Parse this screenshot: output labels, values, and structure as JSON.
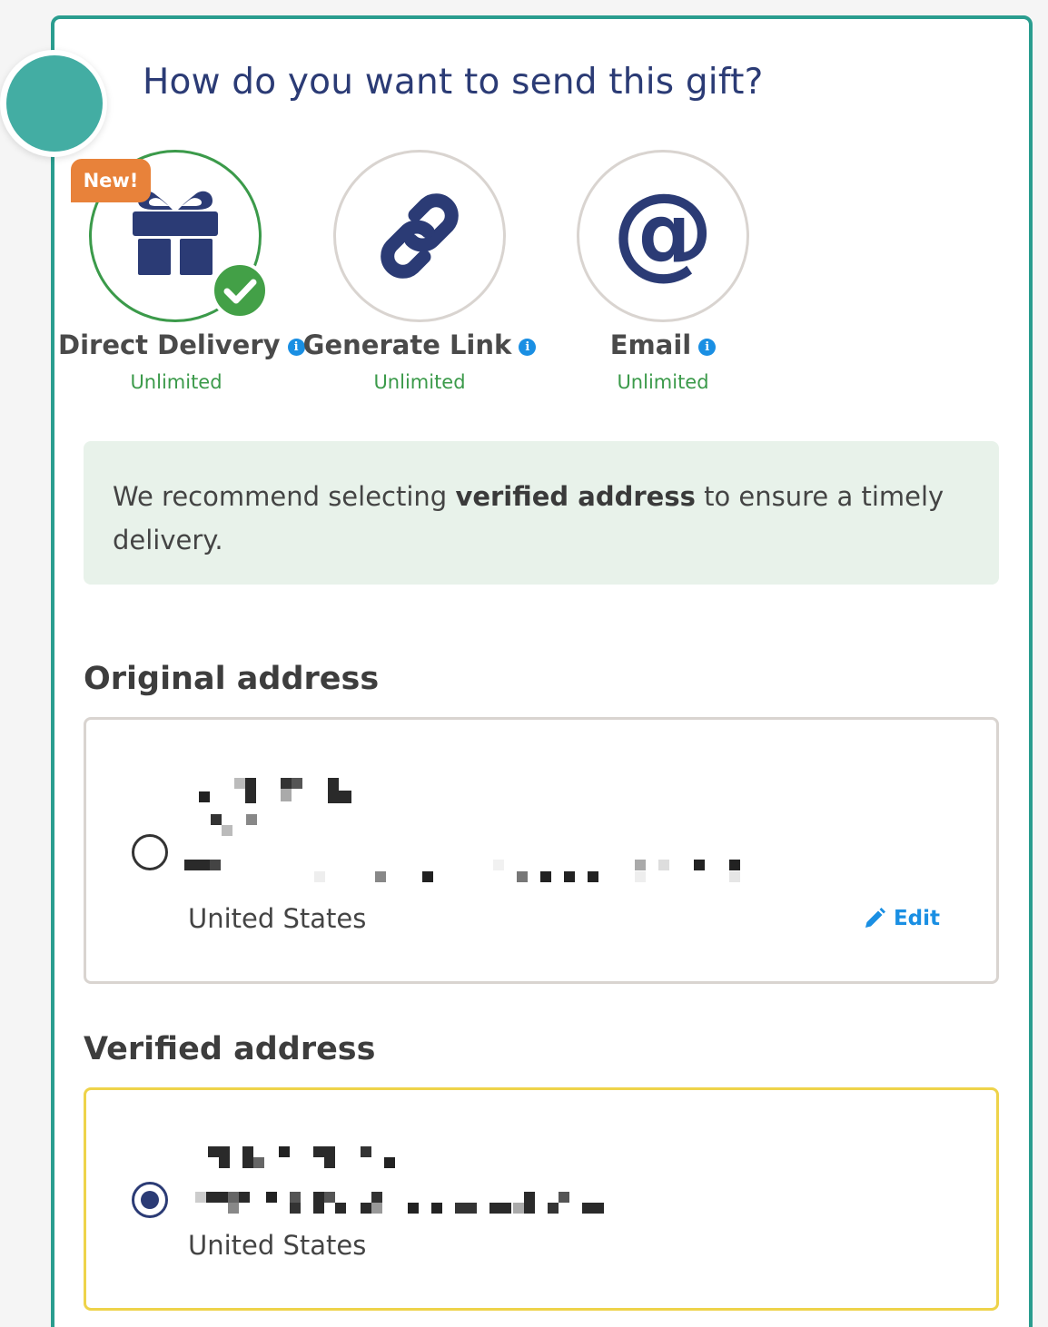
{
  "header": {
    "title": "How do you want to send this gift?"
  },
  "options": [
    {
      "label": "Direct Delivery",
      "sub": "Unlimited",
      "icon": "gift-icon",
      "selected": true,
      "badge": "New!"
    },
    {
      "label": "Generate Link",
      "sub": "Unlimited",
      "icon": "link-icon",
      "selected": false
    },
    {
      "label": "Email",
      "sub": "Unlimited",
      "icon": "at-sign-icon",
      "selected": false
    }
  ],
  "notice": {
    "prefix": "We recommend selecting ",
    "bold": "verified address",
    "suffix": " to ensure a timely delivery."
  },
  "original": {
    "heading": "Original address",
    "country": "United States",
    "edit_label": "Edit",
    "selected": false
  },
  "verified": {
    "heading": "Verified address",
    "country": "United States",
    "selected": true
  },
  "colors": {
    "accent": "#2a9d8f",
    "title": "#2b3b75",
    "success": "#3b9a4a",
    "badge": "#e8823a",
    "link": "#1a8fe3",
    "highlight_border": "#eed34a",
    "notice_bg": "#e8f2ea"
  }
}
